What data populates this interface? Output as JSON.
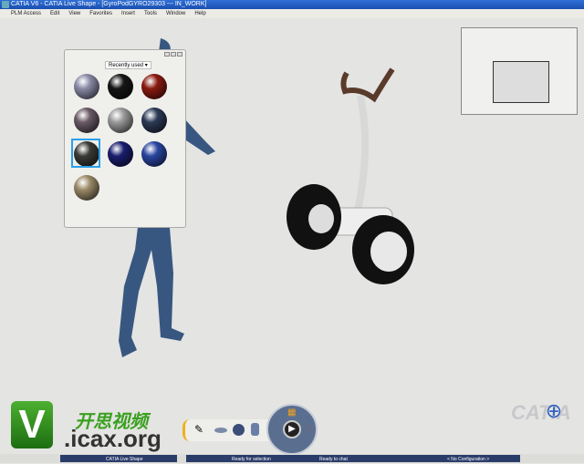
{
  "window": {
    "title": "CATIA V6 - CATIA Live Shape - [GyroPodGYRO29303 --- IN_WORK]"
  },
  "menu": [
    "PLM Access",
    "Edit",
    "View",
    "Favorites",
    "Insert",
    "Tools",
    "Window",
    "Help"
  ],
  "materials_panel": {
    "filter": "Recently used",
    "materials": [
      {
        "color": "#8a8aa8"
      },
      {
        "color": "#151515"
      },
      {
        "color": "#8a1a10"
      },
      {
        "color": "#6a5a66"
      },
      {
        "color": "#9a9a9a"
      },
      {
        "color": "#2c3a55"
      },
      {
        "color": "#3a3a36"
      },
      {
        "color": "#1a1e6e"
      },
      {
        "color": "#2a46a0"
      },
      {
        "color": "#9a8a68"
      }
    ],
    "selected_index": 6
  },
  "watermark": {
    "chinese": "开思视频",
    "url": ".icax.org",
    "letter": "V"
  },
  "status_bar": [
    "CATIA Live Shape",
    "Ready for selection",
    "Ready to chat",
    "< No Configuration >"
  ],
  "brand": "CATIA"
}
